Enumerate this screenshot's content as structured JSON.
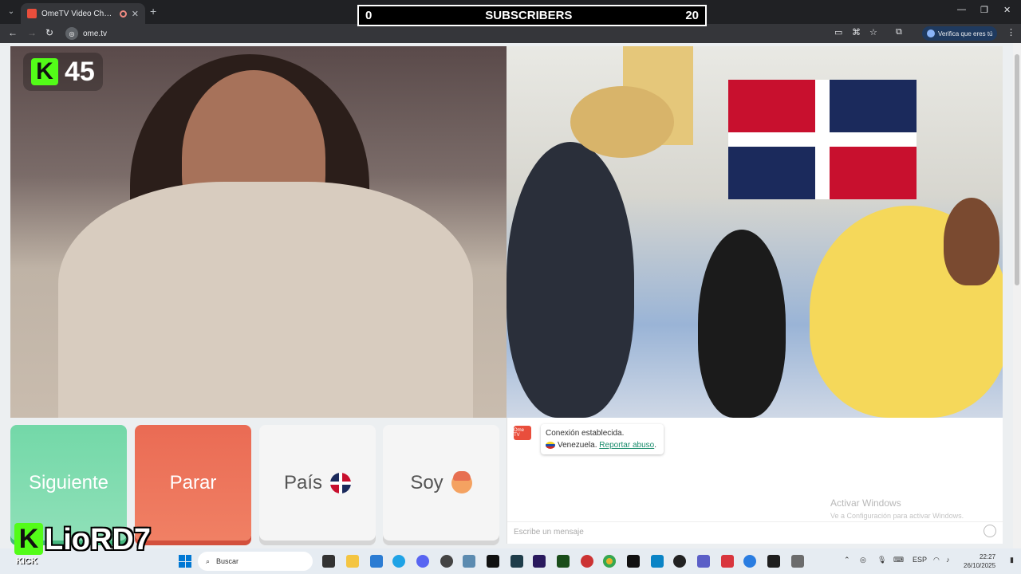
{
  "browser": {
    "tab_title": "OmeTV Video Chat — Ome",
    "url": "ome.tv",
    "verify_label": "Verifica que eres tú"
  },
  "overlay": {
    "subs_current": "0",
    "subs_label": "SUBSCRIBERS",
    "subs_goal": "20",
    "kick_count": "45",
    "streamer_name": "LioRD7",
    "kick_label": "KICK"
  },
  "buttons": {
    "next": "Siguiente",
    "stop": "Parar",
    "country": "País",
    "gender": "Soy"
  },
  "chat": {
    "status": "Conexión establecida.",
    "country": "Venezuela.",
    "report": "Reportar abuso",
    "report_suffix": ".",
    "placeholder": "Escribe un mensaje",
    "activate_title": "Activar Windows",
    "activate_sub": "Ve a Configuración para activar Windows."
  },
  "taskbar": {
    "search": "Buscar",
    "lang": "ESP",
    "time": "22:27",
    "date": "26/10/2025"
  },
  "colors": {
    "next": "#7fdcb0",
    "stop": "#ec7459",
    "kick_green": "#53fc18"
  }
}
